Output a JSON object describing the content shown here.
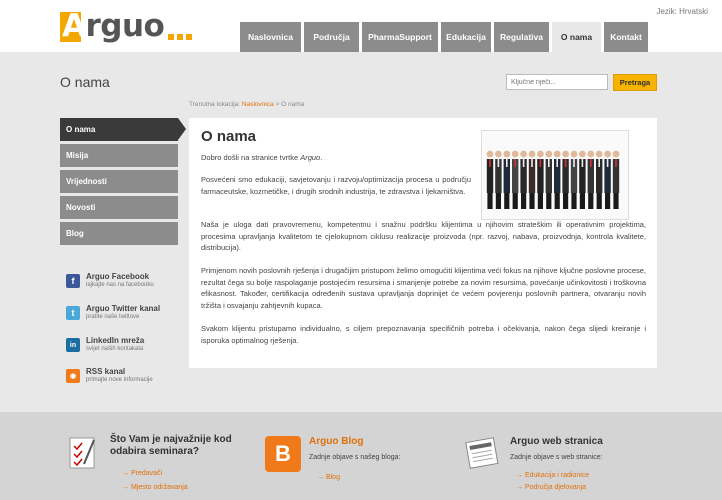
{
  "header": {
    "logo_text": "Arguo",
    "logo_first": "A",
    "logo_rest": "rguo",
    "language": "Jezik: Hrvatski",
    "nav": [
      {
        "label": "Naslovnica"
      },
      {
        "label": "Područja"
      },
      {
        "label": "PharmaSupport"
      },
      {
        "label": "Edukacija"
      },
      {
        "label": "Regulativa"
      },
      {
        "label": "O nama",
        "active": true
      },
      {
        "label": "Kontakt"
      }
    ]
  },
  "titlebar": {
    "title": "O nama",
    "search_placeholder": "Ključne riječi...",
    "search_button": "Pretraga"
  },
  "breadcrumb": {
    "prefix": "Trenutna lokacija:",
    "home": "Naslovnica",
    "separator": ">",
    "current": "O nama"
  },
  "sidebar": {
    "items": [
      {
        "label": "O nama",
        "active": true
      },
      {
        "label": "Misija"
      },
      {
        "label": "Vrijednosti"
      },
      {
        "label": "Novosti"
      },
      {
        "label": "Blog"
      }
    ],
    "social": [
      {
        "title": "Arguo Facebook",
        "sub": "lajkajte nas na facebooku",
        "icon": "facebook-icon",
        "color": "#3b5998",
        "glyph": "f"
      },
      {
        "title": "Arguo Twitter kanal",
        "sub": "pratite naše twittove",
        "icon": "twitter-icon",
        "color": "#4aa8d8",
        "glyph": "t"
      },
      {
        "title": "LinkedIn mreža",
        "sub": "svijet naših kontakata",
        "icon": "linkedin-icon",
        "color": "#1c6ea0",
        "glyph": "in"
      },
      {
        "title": "RSS kanal",
        "sub": "primajte nove informacije",
        "icon": "rss-icon",
        "color": "#f07a1a",
        "glyph": "◉"
      }
    ]
  },
  "content": {
    "heading": "O nama",
    "p1_text": "Dobro došli na stranice tvrtke ",
    "p1_em": "Arguo",
    "p1_end": ".",
    "p2": "Posvećeni smo edukaciji, savjetovanju i razvoju/optimizacija procesa u području farmaceutske, kozmetičke, i drugih srodnih industrija, te zdravstva i ljekarništva.",
    "p3": "Naša je uloga dati pravovremenu, kompetentnu i snažnu podršku klijentima u njihovim strateškim ili operativnim projektima, procesima upravljanja kvalitetom te cjelokupnom ciklusu realizacije proizvoda (npr. razvoj, nabava, proizvodnja, kontrola kvalitete, distribucija).",
    "p4": "Primjenom novih poslovnih rješenja i drugačijim pristupom želimo omogućiti klijentima veći fokus na njihove ključne poslovne procese, rezultat čega su bolje raspolaganje postojećim resursima i smanjenje potrebe za novim resursima, povećanje učinkovitosti i troškovna efikasnost. Također, certifikacija određenih sustava upravljanja doprinijet će većem povjerenju poslovnih partnera, otvaranju novih tržišta i osvajanju zahtjevnih kupaca.",
    "p5": "Svakom klijentu pristupamo individualno, s ciljem prepoznavanja specifičnih potreba i očekivanja, nakon čega slijedi kreiranje i isporuka optimalnog rješenja."
  },
  "footer": {
    "col1": {
      "title": "Što Vam je najvažnije kod odabira seminara?",
      "links": [
        "Predavači",
        "Mjesto održavanja"
      ]
    },
    "col2": {
      "title": "Arguo Blog",
      "sub": "Zadnje objave s našeg bloga:",
      "links": [
        "Blog"
      ]
    },
    "col3": {
      "title": "Arguo web stranica",
      "sub": "Zadnje objave s web stranice:",
      "links": [
        "Edukacija i radionice",
        "Područja djelovanja"
      ]
    }
  },
  "colors": {
    "accent": "#f2a800",
    "nav": "#8c8c8c",
    "link": "#e0700a"
  }
}
